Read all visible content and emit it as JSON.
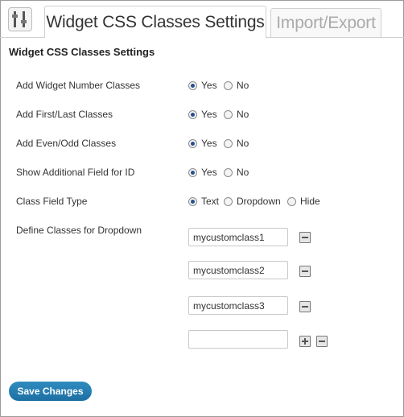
{
  "tabs": {
    "active": "Widget CSS Classes Settings",
    "inactive": "Import/Export"
  },
  "section_title": "Widget CSS Classes Settings",
  "settings": [
    {
      "label": "Add Widget Number Classes",
      "options": [
        "Yes",
        "No"
      ],
      "selected": "Yes"
    },
    {
      "label": "Add First/Last Classes",
      "options": [
        "Yes",
        "No"
      ],
      "selected": "Yes"
    },
    {
      "label": "Add Even/Odd Classes",
      "options": [
        "Yes",
        "No"
      ],
      "selected": "Yes"
    },
    {
      "label": "Show Additional Field for ID",
      "options": [
        "Yes",
        "No"
      ],
      "selected": "Yes"
    },
    {
      "label": "Class Field Type",
      "options": [
        "Text",
        "Dropdown",
        "Hide"
      ],
      "selected": "Text"
    }
  ],
  "dropdown_classes": {
    "label": "Define Classes for Dropdown",
    "values": [
      "mycustomclass1",
      "mycustomclass2",
      "mycustomclass3",
      ""
    ]
  },
  "save_button": "Save Changes",
  "colors": {
    "save_button": "#2a7fb5",
    "radio_dot": "#2a4f8e"
  }
}
